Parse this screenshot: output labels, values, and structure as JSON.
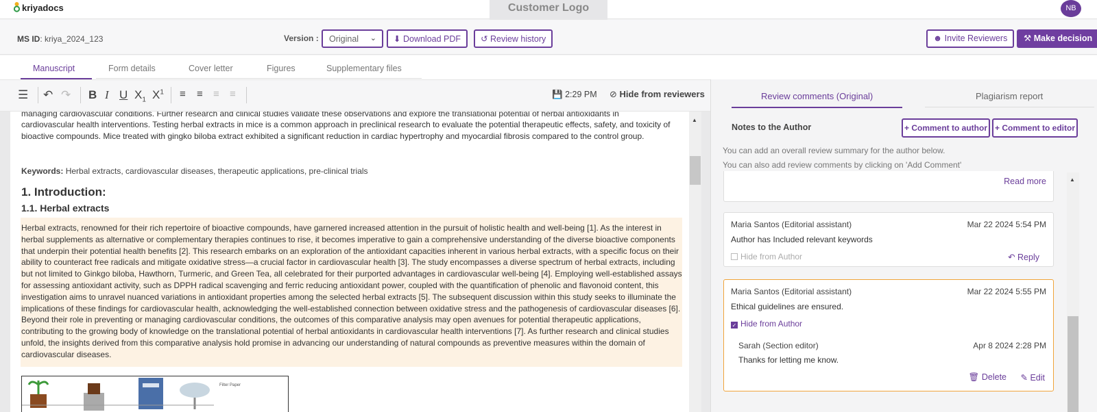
{
  "app": {
    "logo_text": "kriyadocs",
    "customer_logo": "Customer Logo",
    "avatar_initials": "NB",
    "brand_color": "#6a3d9a",
    "highlight_color": "#fdf2e3"
  },
  "msbar": {
    "msid_label": "MS ID",
    "msid_value": ": kriya_2024_123",
    "version_label": "Version :",
    "version_value": "Original",
    "download_label": "Download PDF",
    "history_label": "Review history",
    "invite_label": "Invite Reviewers",
    "decision_label": "Make decision"
  },
  "tabs": [
    "Manuscript",
    "Form details",
    "Cover letter",
    "Figures",
    "Supplementary files"
  ],
  "toolbar": {
    "save_time": "2:29 PM",
    "hide_label": "Hide from reviewers"
  },
  "document": {
    "cut_line": "managing cardiovascular conditions. Further research and clinical studies validate these observations and explore the translational potential of herbal antioxidants in",
    "abstract_tail": "cardiovascular health interventions. Testing herbal extracts in mice is a common approach in preclinical research to evaluate the potential therapeutic effects, safety, and toxicity of bioactive compounds. Mice treated with gingko biloba extract exhibited a significant reduction in cardiac hypertrophy and myocardial fibrosis compared to the control group.",
    "keywords_label": "Keywords:",
    "keywords": " Herbal extracts, cardiovascular diseases, therapeutic applications, pre-clinical trials",
    "h1": "1. Introduction:",
    "h2": "1.1. Herbal extracts",
    "paragraph": "Herbal extracts, renowned for their rich repertoire of bioactive compounds, have garnered increased attention in the pursuit of holistic health and well-being [1]. As the interest in herbal supplements as alternative or complementary therapies continues to rise, it becomes imperative to gain a comprehensive understanding of the diverse bioactive components that underpin their potential health benefits [2]. This research embarks on an exploration of the antioxidant capacities inherent in various herbal extracts, with a specific focus on their ability to counteract free radicals and mitigate oxidative stress—a crucial factor in cardiovascular health [3]. The study encompasses a diverse spectrum of herbal extracts, including but not limited to Ginkgo biloba, Hawthorn, Turmeric, and Green Tea, all celebrated for their purported advantages in cardiovascular well-being [4]. Employing well-established assays for assessing antioxidant activity, such as DPPH radical scavenging and ferric reducing antioxidant power, coupled with the quantification of phenolic and flavonoid content, this investigation aims to unravel nuanced variations in antioxidant properties among the selected herbal extracts [5]. The subsequent discussion within this study seeks to illuminate the implications of these findings for cardiovascular health, acknowledging the well-established connection between oxidative stress and the pathogenesis of cardiovascular diseases [6]. Beyond their role in preventing or managing cardiovascular conditions, the outcomes of this comparative analysis may open avenues for potential therapeutic applications, contributing to the growing body of knowledge on the translational potential of herbal antioxidants in cardiovascular health interventions [7]. As further research and clinical studies unfold, the insights derived from this comparative analysis hold promise in advancing our understanding of natural compounds as preventive measures within the domain of cardiovascular diseases.",
    "figure_labels": {
      "filter": "Filter Paper"
    }
  },
  "review": {
    "tabs": [
      "Review comments (Original)",
      "Plagiarism report"
    ],
    "notes_title": "Notes to the Author",
    "comment_author_label": "+ Comment to author",
    "comment_editor_label": "+ Comment to editor",
    "info1": "You can add an overall review summary for the author below.",
    "info2": "You can also add review comments by clicking on 'Add Comment'",
    "read_more": "Read more",
    "comments": [
      {
        "author": "Maria Santos (Editorial assistant)",
        "date": "Mar 22 2024 5:54 PM",
        "text": "Author has Included relevant keywords",
        "hide_label": "Hide from Author",
        "reply_label": "Reply"
      },
      {
        "author": "Maria Santos (Editorial assistant)",
        "date": "Mar 22 2024 5:55 PM",
        "text": "Ethical guidelines are ensured.",
        "hide_label": "Hide from Author",
        "reply": {
          "author": "Sarah (Section editor)",
          "date": "Apr 8 2024 2:28 PM",
          "text": "Thanks for letting me know.",
          "delete_label": "Delete",
          "edit_label": "Edit"
        }
      }
    ]
  }
}
